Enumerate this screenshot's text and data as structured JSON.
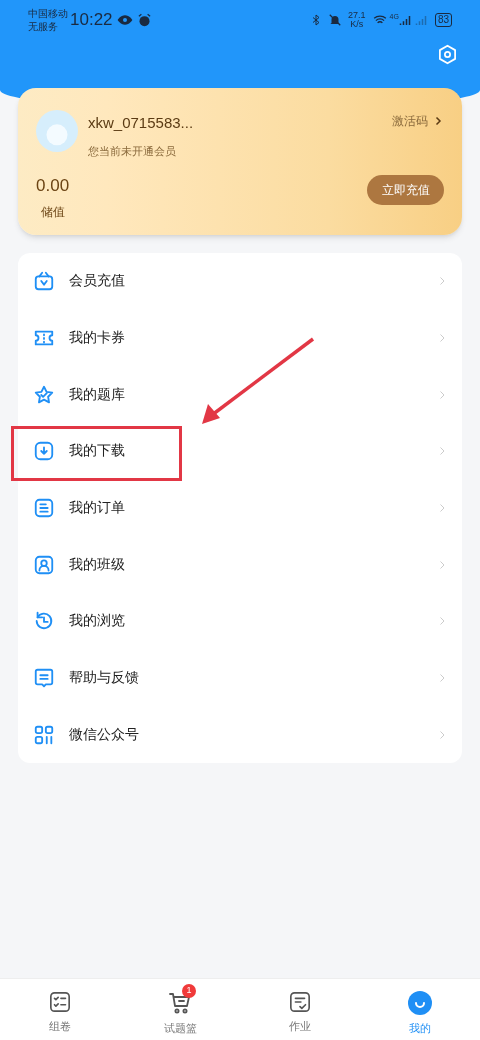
{
  "status_bar": {
    "carrier": "中国移动",
    "service": "无服务",
    "time": "10:22",
    "speed_value": "27.1",
    "speed_unit": "K/s",
    "network": "4G",
    "battery": "83"
  },
  "profile": {
    "username": "xkw_0715583...",
    "membership": "您当前未开通会员",
    "activation_link": "激活码",
    "balance": "0.00",
    "balance_label": "储值",
    "recharge_button": "立即充值"
  },
  "menu": [
    {
      "kind": "vip",
      "label": "会员充值",
      "highlighted": false
    },
    {
      "kind": "coupon",
      "label": "我的卡券",
      "highlighted": false
    },
    {
      "kind": "star",
      "label": "我的题库",
      "highlighted": false
    },
    {
      "kind": "download",
      "label": "我的下载",
      "highlighted": true
    },
    {
      "kind": "order",
      "label": "我的订单",
      "highlighted": false
    },
    {
      "kind": "class",
      "label": "我的班级",
      "highlighted": false
    },
    {
      "kind": "history",
      "label": "我的浏览",
      "highlighted": false
    },
    {
      "kind": "feedback",
      "label": "帮助与反馈",
      "highlighted": false
    },
    {
      "kind": "grid",
      "label": "微信公众号",
      "highlighted": false
    }
  ],
  "bottom_nav": [
    {
      "kind": "compose",
      "label": "组卷",
      "selected": false
    },
    {
      "kind": "cart",
      "label": "试题篮",
      "selected": false,
      "badge": "1"
    },
    {
      "kind": "homework",
      "label": "作业",
      "selected": false
    },
    {
      "kind": "me",
      "label": "我的",
      "selected": true
    }
  ]
}
